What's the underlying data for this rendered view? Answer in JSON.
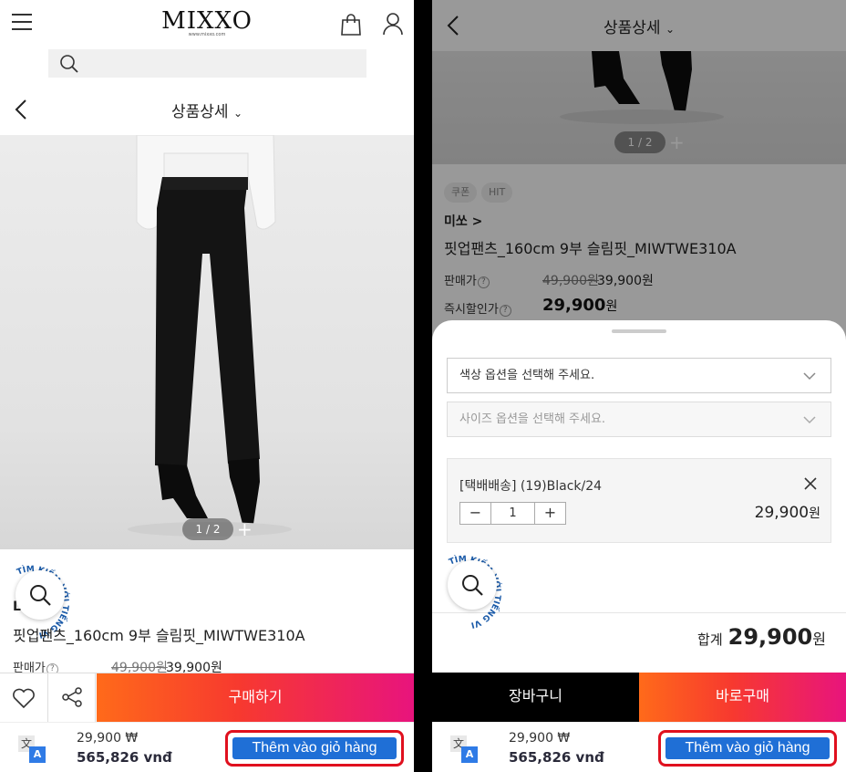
{
  "colors": {
    "accent_start": "#ff6a1a",
    "accent_end": "#e8147d",
    "highlight": "#e0101e",
    "translate_blue": "#1f6fd6"
  },
  "header": {
    "logo": "MIXXO",
    "logo_sub": "www.mixxo.com"
  },
  "detail": {
    "title": "상품상세",
    "chevron": "⌄"
  },
  "gallery": {
    "counter": "1 / 2",
    "more": "+"
  },
  "zoom_badge": {
    "ring_text": "TÌM KIẾM VỚI TIẾNG VIỆT"
  },
  "product": {
    "chips": [
      "쿠폰",
      "HIT"
    ],
    "brand": "미쏘 >",
    "brand_partial": "L",
    "name": "핏업팬츠_160cm 9부 슬림핏_MIWTWE310A",
    "price_label": "판매가",
    "instant_label": "즉시할인가",
    "help": "?",
    "original_price": "49,900원",
    "sale_price": "39,900원",
    "instant_price": "29,900",
    "won": "원"
  },
  "actions": {
    "buy": "구매하기",
    "add_cart": "장바구니",
    "buy_now": "바로구매"
  },
  "options": {
    "color_placeholder": "색상 옵션을 선택해 주세요.",
    "size_placeholder": "사이즈 옵션을 선택해 주세요.",
    "selected_name": "[택배배송] (19)Black/24",
    "quantity": "1",
    "minus": "−",
    "plus": "+",
    "item_price": "29,900",
    "total_label": "합계",
    "total_price": "29,900"
  },
  "translate_bar": {
    "icon_zh": "文",
    "icon_a": "A",
    "price_krw": "29,900 ₩",
    "price_vnd": "565,826 vnđ",
    "add_to_cart": "Thêm vào giỏ hàng"
  }
}
